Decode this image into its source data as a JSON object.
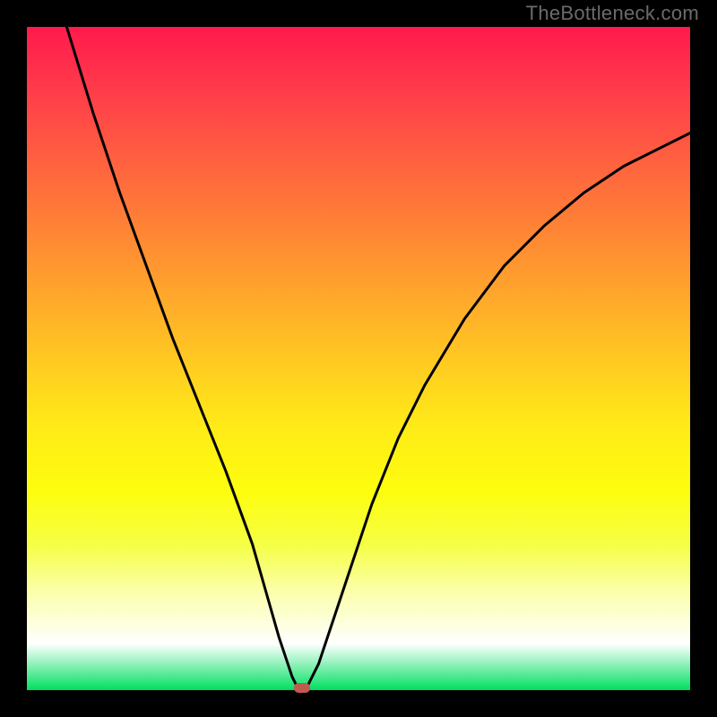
{
  "watermark": "TheBottleneck.com",
  "chart_data": {
    "type": "line",
    "title": "",
    "xlabel": "",
    "ylabel": "",
    "xlim": [
      0,
      100
    ],
    "ylim": [
      0,
      100
    ],
    "series": [
      {
        "name": "bottleneck-curve",
        "x": [
          6,
          10,
          14,
          18,
          22,
          26,
          30,
          34,
          36,
          38,
          40,
          41,
          42,
          44,
          48,
          52,
          56,
          60,
          66,
          72,
          78,
          84,
          90,
          96,
          100
        ],
        "y": [
          100,
          87,
          75,
          64,
          53,
          43,
          33,
          22,
          15,
          8,
          2,
          0,
          0,
          4,
          16,
          28,
          38,
          46,
          56,
          64,
          70,
          75,
          79,
          82,
          84
        ]
      }
    ],
    "marker": {
      "x": 41.5,
      "y": 0,
      "color": "#c05a50"
    },
    "gradient_colors": {
      "top": "#ff1a4d",
      "mid": "#ffea18",
      "bottom": "#00e060"
    },
    "background": "#000000"
  }
}
